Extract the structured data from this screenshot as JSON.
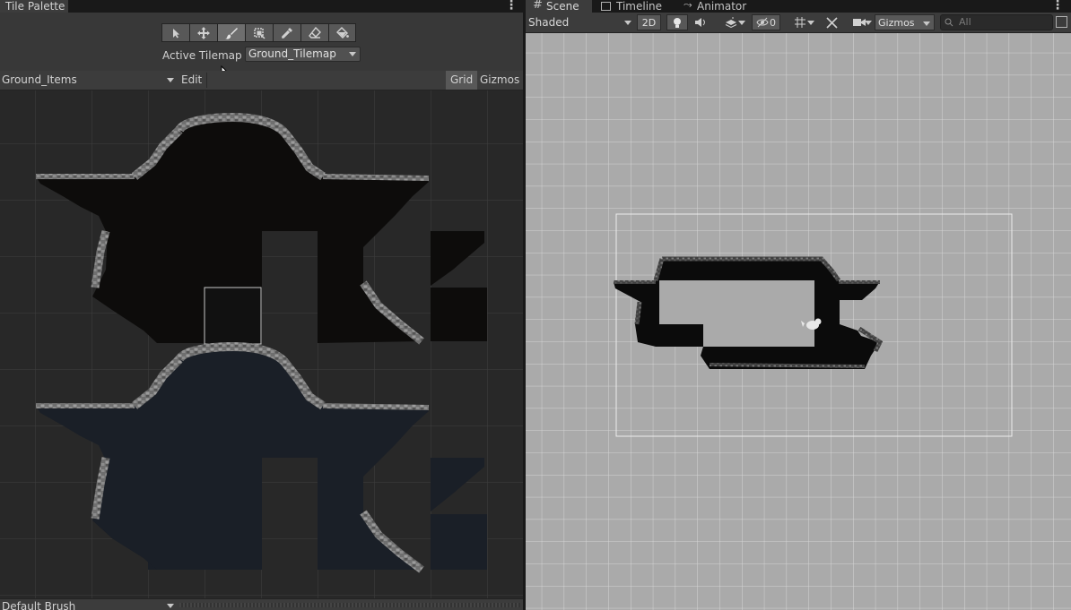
{
  "left_panel": {
    "tab_title": "Tile Palette",
    "active_tilemap_label": "Active Tilemap",
    "active_tilemap_value": "Ground_Tilemap",
    "palette_name": "Ground_Items",
    "edit_label": "Edit",
    "grid_label": "Grid",
    "gizmos_label": "Gizmos",
    "brush_name": "Default Brush",
    "tools": [
      "select-tool",
      "move-tool",
      "paint-brush-tool",
      "box-fill-tool",
      "picker-tool",
      "eraser-tool",
      "fill-bucket-tool"
    ],
    "active_tool": "paint-brush-tool"
  },
  "right_panel": {
    "tabs": [
      {
        "label": "Scene",
        "icon": "hash-grid-icon"
      },
      {
        "label": "Timeline",
        "icon": "timeline-icon"
      },
      {
        "label": "Animator",
        "icon": "animator-icon"
      }
    ],
    "draw_mode": "Shaded",
    "mode_2d": "2D",
    "hidden_count": "0",
    "gizmos_label": "Gizmos",
    "search_placeholder": "All"
  },
  "colors": {
    "panel_bg": "#383838",
    "palette_bg": "#282828",
    "scene_bg": "#aaaaaa",
    "tile_dark": "#0d0c0b",
    "tile_navy": "#1a1f27",
    "rock_grey": "#8a8a8a"
  }
}
